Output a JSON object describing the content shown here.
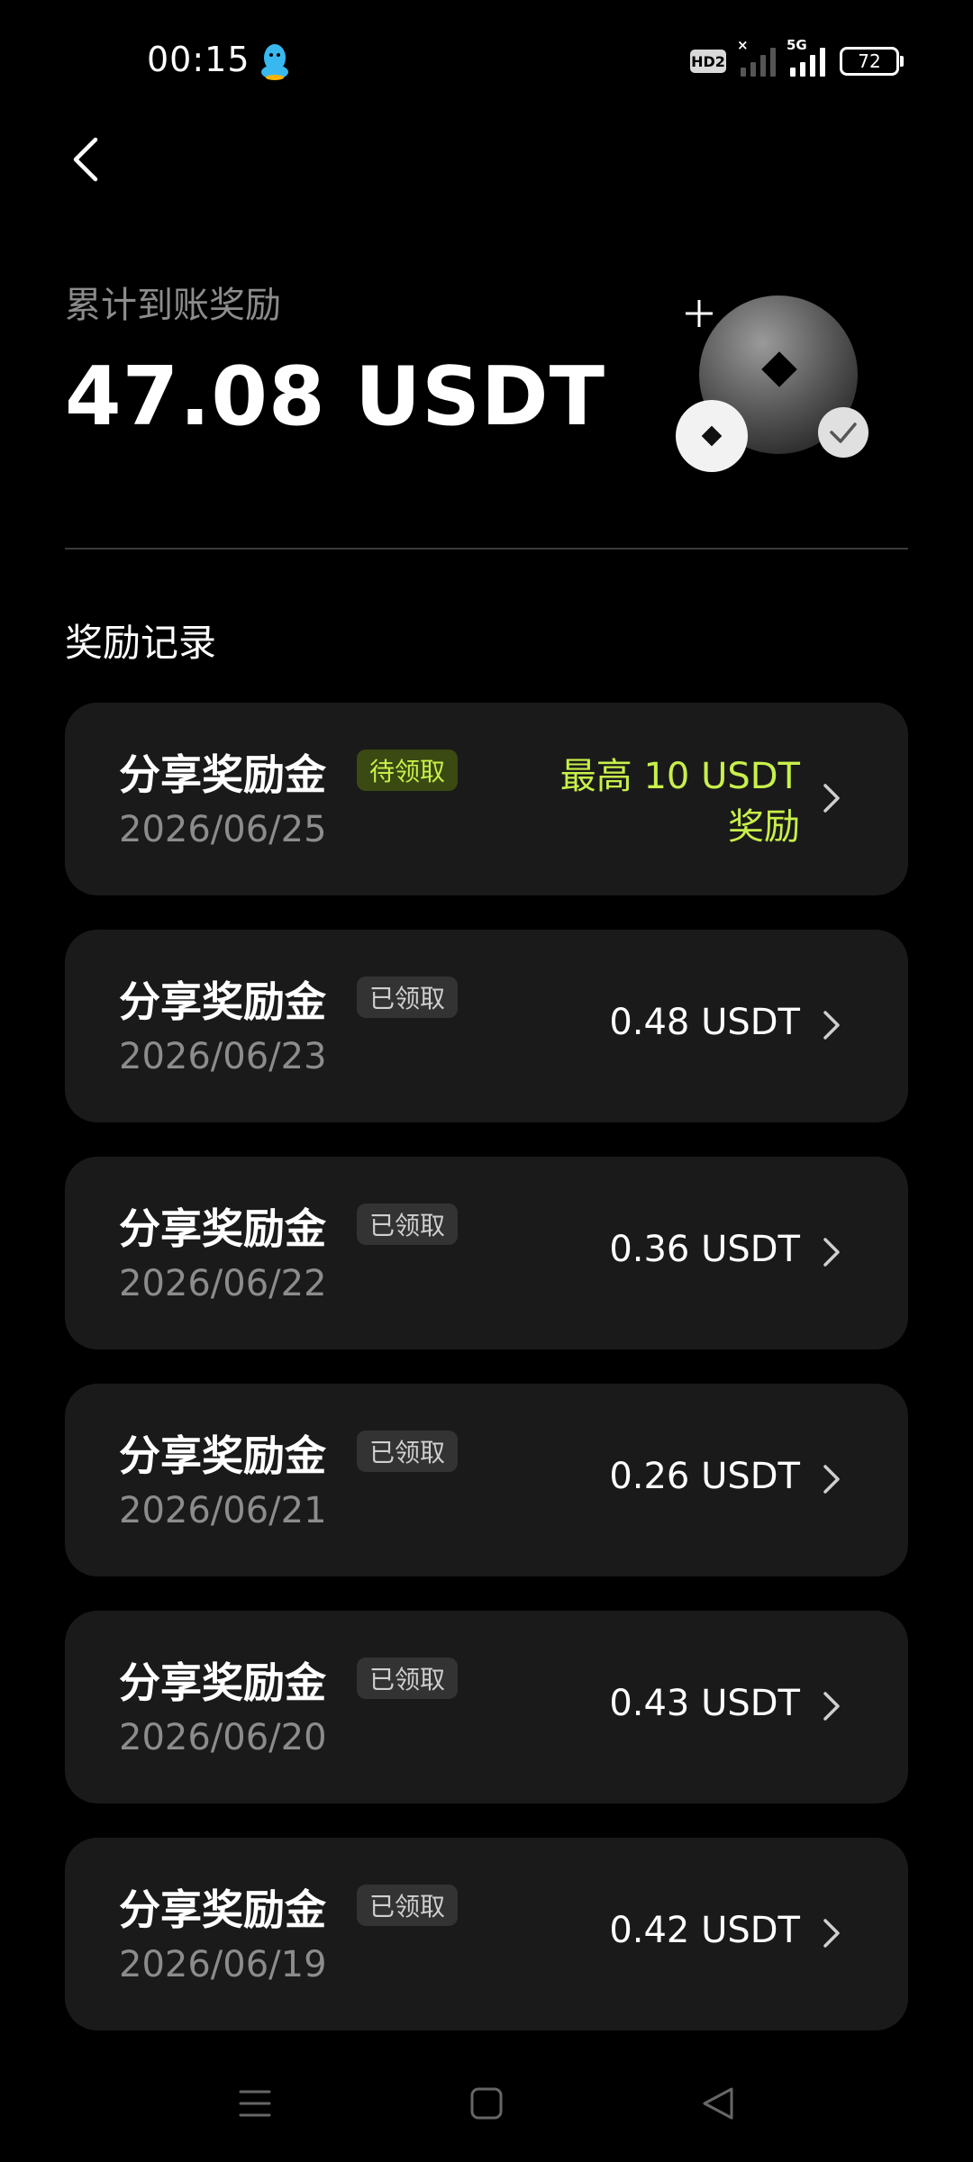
{
  "status_bar": {
    "time": "00:15",
    "hd_label": "HD2",
    "network_label": "5G",
    "battery": "72"
  },
  "header": {
    "total_label": "累计到账奖励",
    "total_value": "47.08 USDT"
  },
  "section": {
    "title": "奖励记录"
  },
  "records": [
    {
      "title": "分享奖励金",
      "badge": "待领取",
      "status": "pending",
      "date": "2026/06/25",
      "amount_line1": "最高 10 USDT",
      "amount_line2": "奖励"
    },
    {
      "title": "分享奖励金",
      "badge": "已领取",
      "status": "claimed",
      "date": "2026/06/23",
      "amount": "0.48 USDT"
    },
    {
      "title": "分享奖励金",
      "badge": "已领取",
      "status": "claimed",
      "date": "2026/06/22",
      "amount": "0.36 USDT"
    },
    {
      "title": "分享奖励金",
      "badge": "已领取",
      "status": "claimed",
      "date": "2026/06/21",
      "amount": "0.26 USDT"
    },
    {
      "title": "分享奖励金",
      "badge": "已领取",
      "status": "claimed",
      "date": "2026/06/20",
      "amount": "0.43 USDT"
    },
    {
      "title": "分享奖励金",
      "badge": "已领取",
      "status": "claimed",
      "date": "2026/06/19",
      "amount": "0.42 USDT"
    }
  ],
  "colors": {
    "background": "#000000",
    "card": "#1a1a1a",
    "accent_green": "#c8f04a",
    "muted_text": "#8c8c8c"
  },
  "icons": {
    "back": "chevron-left-icon",
    "row_arrow": "chevron-right-icon",
    "nav_menu": "menu-icon",
    "nav_home": "home-square-icon",
    "nav_back": "triangle-back-icon",
    "status_app": "qq-penguin-icon"
  }
}
